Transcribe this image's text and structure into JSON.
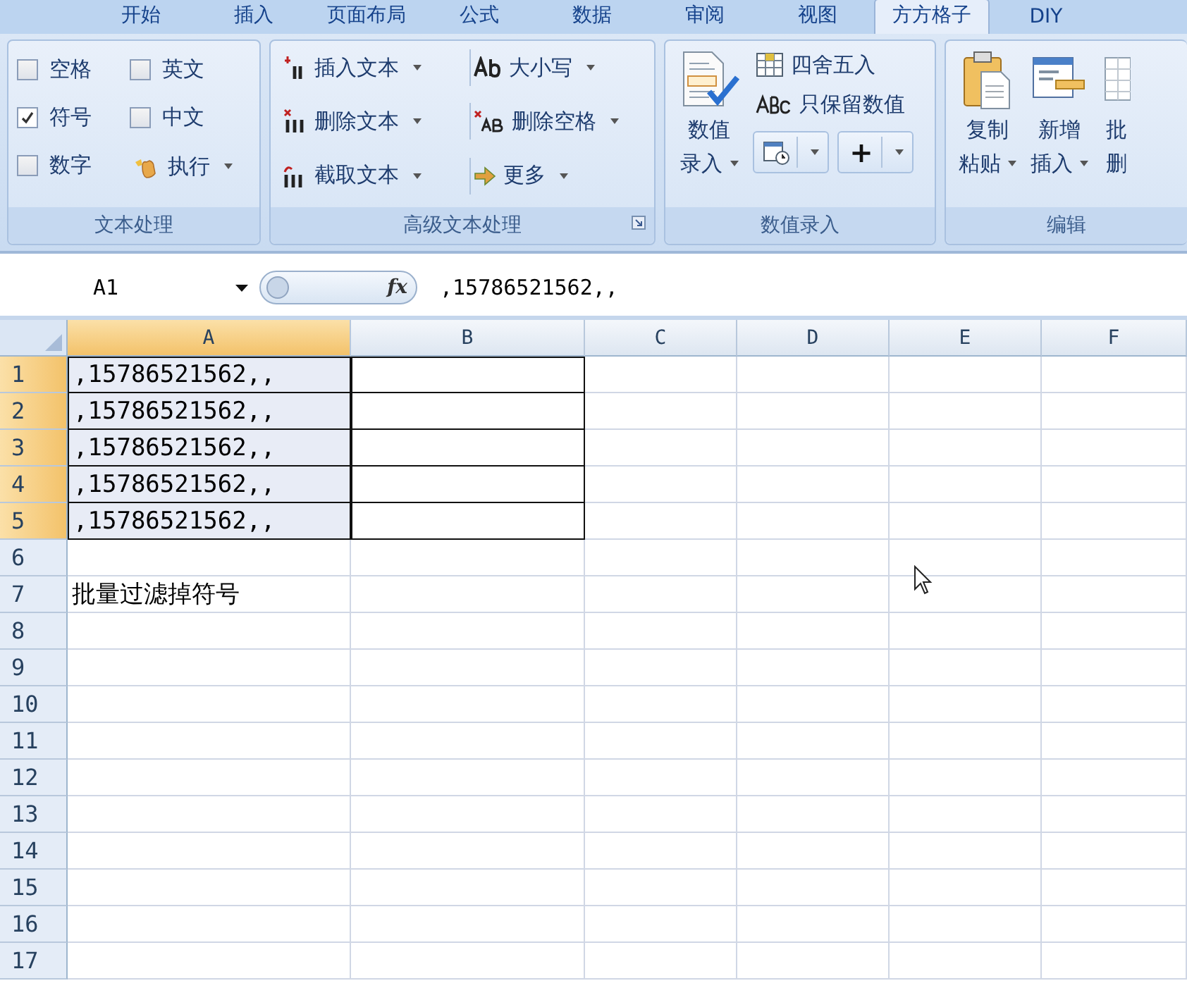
{
  "tabs": [
    {
      "label": "开始",
      "selected": false
    },
    {
      "label": "插入",
      "selected": false
    },
    {
      "label": "页面布局",
      "selected": false
    },
    {
      "label": "公式",
      "selected": false
    },
    {
      "label": "数据",
      "selected": false
    },
    {
      "label": "审阅",
      "selected": false
    },
    {
      "label": "视图",
      "selected": false
    },
    {
      "label": "方方格子",
      "selected": true
    },
    {
      "label": "DIY",
      "selected": false
    }
  ],
  "ribbon": {
    "groups": [
      {
        "title": "文本处理",
        "items": [
          {
            "kind": "checkbox",
            "label": "空格",
            "checked": false
          },
          {
            "kind": "checkbox",
            "label": "英文",
            "checked": false
          },
          {
            "kind": "checkbox",
            "label": "符号",
            "checked": true
          },
          {
            "kind": "checkbox",
            "label": "中文",
            "checked": false
          },
          {
            "kind": "checkbox",
            "label": "数字",
            "checked": false
          },
          {
            "kind": "button",
            "label": "执行",
            "dropdown": true
          }
        ]
      },
      {
        "title": "高级文本处理",
        "launcher": true,
        "items": [
          {
            "label": "插入文本",
            "dropdown": true
          },
          {
            "label": "大小写",
            "dropdown": true
          },
          {
            "label": "删除文本",
            "dropdown": true
          },
          {
            "label": "删除空格",
            "dropdown": true
          },
          {
            "label": "截取文本",
            "dropdown": true
          },
          {
            "label": "更多",
            "dropdown": true
          }
        ]
      },
      {
        "title": "数值录入",
        "items": [
          {
            "kind": "large",
            "lines": [
              "数值",
              "录入"
            ],
            "dropdown": true
          },
          {
            "kind": "button",
            "label": "四舍五入",
            "dropdown": false
          },
          {
            "kind": "button",
            "label": "只保留数值",
            "dropdown": false
          },
          {
            "kind": "split",
            "dropdown": true
          },
          {
            "kind": "split",
            "label": "+",
            "dropdown": true
          }
        ]
      },
      {
        "title": "编辑",
        "items": [
          {
            "lines": [
              "复制",
              "粘贴"
            ],
            "dropdown": true
          },
          {
            "lines": [
              "新增",
              "插入"
            ],
            "dropdown": true
          },
          {
            "lines": [
              "批",
              "删"
            ],
            "dropdown": false
          }
        ]
      }
    ]
  },
  "formula_bar": {
    "name_box": "A1",
    "fx": "fx",
    "formula": ",15786521562,,"
  },
  "sheet": {
    "columns": [
      {
        "label": "A",
        "selected": true,
        "outlined": true
      },
      {
        "label": "B",
        "selected": false,
        "outlined": true
      },
      {
        "label": "C",
        "selected": false,
        "outlined": false
      },
      {
        "label": "D",
        "selected": false,
        "outlined": false
      },
      {
        "label": "E",
        "selected": false,
        "outlined": false
      },
      {
        "label": "F",
        "selected": false,
        "outlined": false
      }
    ],
    "rows": [
      {
        "header": "1",
        "selected": true,
        "outlined": true,
        "cells": [
          ",15786521562,,"
        ]
      },
      {
        "header": "2",
        "selected": true,
        "outlined": true,
        "cells": [
          ",15786521562,,"
        ]
      },
      {
        "header": "3",
        "selected": true,
        "outlined": true,
        "cells": [
          ",15786521562,,"
        ]
      },
      {
        "header": "4",
        "selected": true,
        "outlined": true,
        "cells": [
          ",15786521562,,"
        ]
      },
      {
        "header": "5",
        "selected": true,
        "outlined": true,
        "cells": [
          ",15786521562,,"
        ]
      },
      {
        "header": "6",
        "selected": false,
        "outlined": false,
        "cells": []
      },
      {
        "header": "7",
        "selected": false,
        "outlined": false,
        "cells": [
          "批量过滤掉符号"
        ]
      },
      {
        "header": "8",
        "selected": false,
        "outlined": false,
        "cells": []
      },
      {
        "header": "9",
        "selected": false,
        "outlined": false,
        "cells": []
      },
      {
        "header": "10",
        "selected": false,
        "outlined": false,
        "cells": []
      },
      {
        "header": "11",
        "selected": false,
        "outlined": false,
        "cells": []
      },
      {
        "header": "12",
        "selected": false,
        "outlined": false,
        "cells": []
      },
      {
        "header": "13",
        "selected": false,
        "outlined": false,
        "cells": []
      },
      {
        "header": "14",
        "selected": false,
        "outlined": false,
        "cells": []
      },
      {
        "header": "15",
        "selected": false,
        "outlined": false,
        "cells": []
      },
      {
        "header": "16",
        "selected": false,
        "outlined": false,
        "cells": []
      },
      {
        "header": "17",
        "selected": false,
        "outlined": false,
        "cells": []
      }
    ]
  }
}
